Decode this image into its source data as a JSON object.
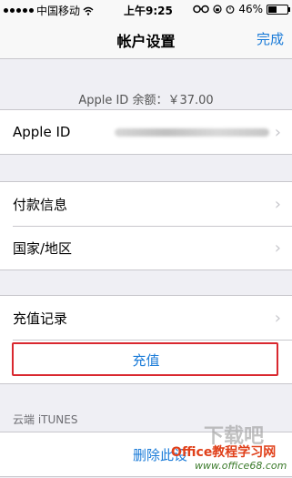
{
  "status_bar": {
    "carrier": "中国移动",
    "time": "上午9:25",
    "battery_percent": "46%",
    "battery_level": 0.46,
    "icons": [
      "signal-dots-icon",
      "wifi-icon",
      "glasses-icon",
      "lock-rotation-icon",
      "alarm-icon",
      "battery-icon"
    ]
  },
  "nav": {
    "title": "帐户设置",
    "done_label": "完成",
    "accent_color": "#1a7bd8"
  },
  "balance_text": "Apple ID 余额：￥37.00",
  "groups": {
    "appleid": {
      "label": "Apple ID"
    },
    "payment": {
      "label": "付款信息"
    },
    "country": {
      "label": "国家/地区"
    },
    "history": {
      "label": "充值记录"
    },
    "recharge": {
      "label": "充值"
    }
  },
  "itunes_section": {
    "header": "云端 iTUNES",
    "delete_label": "删除此设"
  },
  "watermark": {
    "line1": "下载吧",
    "line2": "Office教程学习网",
    "line3": "www.office68.com",
    "highlight_color": "#d9282f"
  }
}
